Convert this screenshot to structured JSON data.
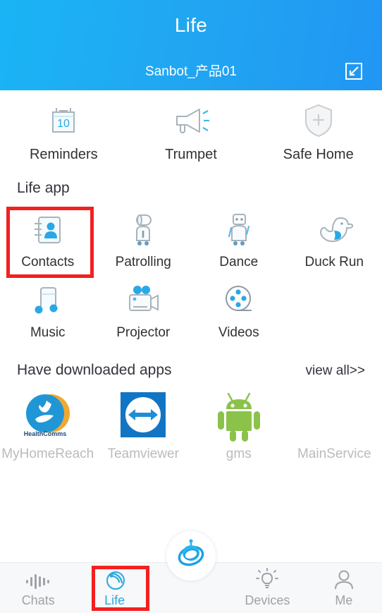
{
  "header": {
    "title": "Life",
    "device_name": "Sanbot_产品01",
    "expand_icon": "collapse-arrow-icon"
  },
  "quick_actions": [
    {
      "label": "Reminders",
      "icon": "calendar-icon",
      "badge": "10"
    },
    {
      "label": "Trumpet",
      "icon": "megaphone-icon"
    },
    {
      "label": "Safe Home",
      "icon": "shield-plus-icon"
    }
  ],
  "life_app": {
    "heading": "Life app",
    "items": [
      {
        "label": "Contacts",
        "icon": "contacts-book-icon",
        "highlighted": true
      },
      {
        "label": "Patrolling",
        "icon": "patrol-robot-icon",
        "highlighted": false
      },
      {
        "label": "Dance",
        "icon": "dance-robot-icon",
        "highlighted": false
      },
      {
        "label": "Duck Run",
        "icon": "duck-icon",
        "highlighted": false
      },
      {
        "label": "Music",
        "icon": "music-note-icon",
        "highlighted": false
      },
      {
        "label": "Projector",
        "icon": "movie-camera-icon",
        "highlighted": false
      },
      {
        "label": "Videos",
        "icon": "film-reel-icon",
        "highlighted": false
      }
    ]
  },
  "downloaded": {
    "heading": "Have downloaded apps",
    "view_all": "view all>>",
    "items": [
      {
        "label": "MyHomeReach",
        "icon": "healthcomms-logo-icon",
        "icon_text": "HealthComms"
      },
      {
        "label": "Teamviewer",
        "icon": "teamviewer-logo-icon"
      },
      {
        "label": "gms",
        "icon": "android-robot-icon"
      },
      {
        "label": "MainService",
        "icon": "none"
      }
    ]
  },
  "bottom_nav": {
    "items": [
      {
        "label": "Chats",
        "icon": "waveform-icon",
        "active": false,
        "highlighted": false
      },
      {
        "label": "Life",
        "icon": "life-radar-icon",
        "active": true,
        "highlighted": true
      },
      {
        "label": "Devices",
        "icon": "lightbulb-icon",
        "active": false,
        "highlighted": false
      },
      {
        "label": "Me",
        "icon": "person-icon",
        "active": false,
        "highlighted": false
      }
    ],
    "center_button": {
      "icon": "sanbot-robot-icon"
    }
  },
  "colors": {
    "header_blue": "#21a7f2",
    "accent_blue": "#2aa9e0",
    "highlight_red": "#f32020",
    "icon_gray": "#a9b3bb",
    "label_dark": "#2f3133",
    "label_muted": "#b9bbbe"
  }
}
